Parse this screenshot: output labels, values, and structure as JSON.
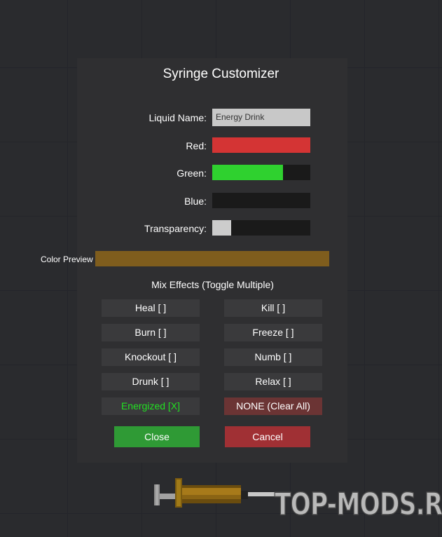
{
  "dialog": {
    "title": "Syringe Customizer",
    "liquid_name_label": "Liquid Name:",
    "liquid_name_value": "Energy Drink",
    "red_label": "Red:",
    "green_label": "Green:",
    "blue_label": "Blue:",
    "transparency_label": "Transparency:",
    "sliders": {
      "red": 1.0,
      "green": 0.72,
      "blue": 0.0,
      "transparency": 0.19
    },
    "colors": {
      "red": "#d43434",
      "green": "#2fd12f",
      "transparency": "#cccccc",
      "preview": "#7f5d1d"
    },
    "color_preview_label": "Color Preview",
    "mix_effects_title": "Mix Effects (Toggle Multiple)",
    "effects": [
      {
        "label": "Heal [ ]",
        "active": false
      },
      {
        "label": "Kill [ ]",
        "active": false
      },
      {
        "label": "Burn [ ]",
        "active": false
      },
      {
        "label": "Freeze [ ]",
        "active": false
      },
      {
        "label": "Knockout [ ]",
        "active": false
      },
      {
        "label": "Numb [ ]",
        "active": false
      },
      {
        "label": "Drunk [ ]",
        "active": false
      },
      {
        "label": "Relax [ ]",
        "active": false
      },
      {
        "label": "Energized [X]",
        "active": true
      },
      {
        "label": "NONE (Clear All)",
        "active": false
      }
    ],
    "close_label": "Close",
    "cancel_label": "Cancel"
  },
  "watermark": "TOP-MODS.RU"
}
